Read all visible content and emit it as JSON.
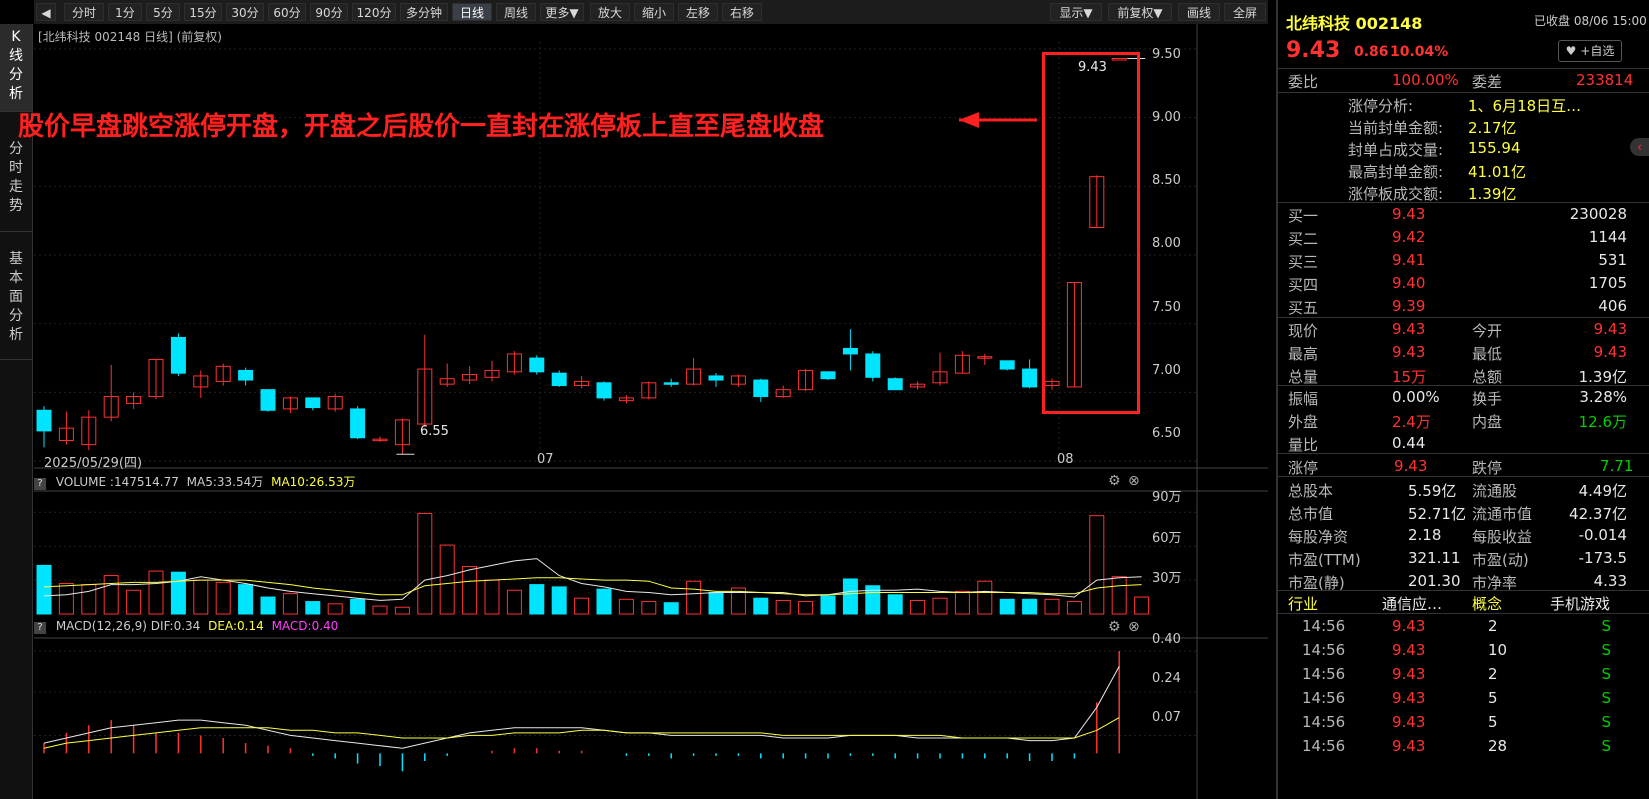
{
  "toolbar": {
    "back_icon": "back-arrow-icon",
    "periods": [
      "分时",
      "1分",
      "5分",
      "15分",
      "30分",
      "60分",
      "90分",
      "120分",
      "多分钟",
      "日线",
      "周线",
      "更多▼"
    ],
    "active_period": "日线",
    "actions": [
      "放大",
      "缩小",
      "左移",
      "右移"
    ],
    "right_buttons": [
      "显示▼",
      "前复权▼",
      "画线",
      "全屏"
    ]
  },
  "left_tabs": [
    "K线分析",
    "分时走势",
    "基本面分析"
  ],
  "chart": {
    "header": "[北纬科技 002148 日线]  (前复权)",
    "annotation": "股价早盘跳空涨停开盘，开盘之后股价一直封在涨停板上直至尾盘收盘",
    "start_date_label": "2025/05/29(四)",
    "month_labels": [
      "07",
      "08"
    ],
    "high_marker": "9.43",
    "low_marker": "6.55",
    "highlight_color": "#ff2020"
  },
  "volume_panel": {
    "title_name": "VOLUME",
    "title_value": ":147514.77",
    "ma5_label": "MA5:33.54万",
    "ma10_label": "MA10:26.53万"
  },
  "macd_panel": {
    "title_name": "MACD(12,26,9)",
    "dif_label": "DIF:0.34",
    "dea_label": "DEA:0.14",
    "macd_label": "MACD:0.40"
  },
  "chart_data": [
    {
      "type": "candlestick",
      "title": "[北纬科技 002148 日线]",
      "ylim": [
        6.45,
        9.55
      ],
      "y_ticks": [
        "9.50",
        "9.00",
        "8.50",
        "8.00",
        "7.50",
        "7.00",
        "6.50"
      ],
      "y_tick_values": [
        9.5,
        9.0,
        8.5,
        8.0,
        7.5,
        7.0,
        6.5
      ],
      "candles": [
        [
          6.87,
          6.72,
          6.9,
          6.6
        ],
        [
          6.65,
          6.74,
          6.86,
          6.62
        ],
        [
          6.62,
          6.82,
          6.87,
          6.58
        ],
        [
          6.82,
          6.97,
          7.2,
          6.79
        ],
        [
          6.92,
          6.97,
          7.0,
          6.88
        ],
        [
          6.97,
          7.24,
          7.24,
          6.95
        ],
        [
          7.4,
          7.14,
          7.43,
          7.12
        ],
        [
          7.04,
          7.12,
          7.16,
          6.96
        ],
        [
          7.08,
          7.19,
          7.21,
          7.05
        ],
        [
          7.16,
          7.09,
          7.18,
          7.05
        ],
        [
          7.02,
          6.87,
          7.02,
          6.86
        ],
        [
          6.88,
          6.96,
          6.97,
          6.85
        ],
        [
          6.96,
          6.89,
          6.96,
          6.87
        ],
        [
          6.88,
          6.97,
          6.99,
          6.86
        ],
        [
          6.88,
          6.67,
          6.9,
          6.66
        ],
        [
          6.66,
          6.66,
          6.68,
          6.64
        ],
        [
          6.62,
          6.8,
          6.81,
          6.55
        ],
        [
          6.77,
          7.17,
          7.42,
          6.75
        ],
        [
          7.06,
          7.1,
          7.21,
          7.04
        ],
        [
          7.09,
          7.13,
          7.19,
          7.06
        ],
        [
          7.11,
          7.16,
          7.23,
          7.08
        ],
        [
          7.15,
          7.28,
          7.3,
          7.13
        ],
        [
          7.25,
          7.15,
          7.27,
          7.13
        ],
        [
          7.14,
          7.05,
          7.16,
          7.04
        ],
        [
          7.05,
          7.08,
          7.12,
          7.03
        ],
        [
          7.07,
          6.96,
          7.08,
          6.94
        ],
        [
          6.94,
          6.96,
          6.98,
          6.92
        ],
        [
          6.96,
          7.07,
          7.08,
          6.95
        ],
        [
          7.07,
          7.06,
          7.1,
          7.04
        ],
        [
          7.06,
          7.17,
          7.25,
          7.05
        ],
        [
          7.12,
          7.09,
          7.14,
          7.04
        ],
        [
          7.06,
          7.12,
          7.13,
          7.04
        ],
        [
          7.09,
          6.97,
          7.1,
          6.93
        ],
        [
          6.97,
          7.02,
          7.05,
          6.96
        ],
        [
          7.02,
          7.16,
          7.17,
          7.01
        ],
        [
          7.15,
          7.1,
          7.15,
          7.09
        ],
        [
          7.32,
          7.28,
          7.46,
          7.16
        ],
        [
          7.28,
          7.11,
          7.3,
          7.08
        ],
        [
          7.1,
          7.02,
          7.11,
          7.02
        ],
        [
          7.04,
          7.06,
          7.08,
          7.02
        ],
        [
          7.07,
          7.15,
          7.29,
          7.05
        ],
        [
          7.14,
          7.27,
          7.3,
          7.14
        ],
        [
          7.26,
          7.26,
          7.28,
          7.2
        ],
        [
          7.23,
          7.17,
          7.23,
          7.16
        ],
        [
          7.17,
          7.04,
          7.24,
          7.03
        ],
        [
          7.05,
          7.08,
          7.1,
          7.02
        ],
        [
          7.04,
          7.8,
          7.8,
          7.04
        ],
        [
          8.2,
          8.57,
          8.58,
          8.2
        ],
        [
          9.43,
          9.43,
          9.43,
          9.43
        ]
      ]
    },
    {
      "type": "bar",
      "title": "VOLUME",
      "ylim": [
        0,
        1000000
      ],
      "y_ticks": [
        "90万",
        "60万",
        "30万"
      ],
      "y_tick_values": [
        900000,
        600000,
        300000
      ],
      "values": [
        430000,
        270000,
        260000,
        340000,
        210000,
        380000,
        370000,
        300000,
        280000,
        260000,
        150000,
        180000,
        110000,
        90000,
        130000,
        70000,
        60000,
        890000,
        610000,
        420000,
        300000,
        210000,
        260000,
        240000,
        140000,
        220000,
        130000,
        110000,
        100000,
        290000,
        190000,
        230000,
        140000,
        120000,
        110000,
        160000,
        310000,
        250000,
        170000,
        120000,
        140000,
        200000,
        290000,
        130000,
        130000,
        130000,
        110000,
        870000,
        330000,
        150000
      ],
      "ma5": [
        160000,
        170000,
        200000,
        260000,
        260000,
        270000,
        290000,
        330000,
        300000,
        270000,
        230000,
        200000,
        180000,
        160000,
        140000,
        120000,
        130000,
        300000,
        340000,
        390000,
        430000,
        470000,
        490000,
        340000,
        270000,
        240000,
        200000,
        190000,
        170000,
        180000,
        190000,
        190000,
        190000,
        190000,
        160000,
        170000,
        200000,
        210000,
        210000,
        220000,
        200000,
        190000,
        200000,
        190000,
        180000,
        170000,
        150000,
        300000,
        320000,
        330000
      ],
      "ma10": [
        240000,
        250000,
        260000,
        270000,
        280000,
        280000,
        290000,
        300000,
        300000,
        300000,
        280000,
        260000,
        230000,
        210000,
        190000,
        170000,
        170000,
        250000,
        270000,
        290000,
        300000,
        310000,
        320000,
        320000,
        310000,
        300000,
        300000,
        290000,
        230000,
        220000,
        200000,
        200000,
        190000,
        180000,
        170000,
        170000,
        180000,
        190000,
        190000,
        190000,
        190000,
        190000,
        190000,
        190000,
        190000,
        180000,
        180000,
        230000,
        250000,
        260000
      ]
    },
    {
      "type": "bar",
      "title": "MACD(12,26,9)",
      "ylim": [
        -0.12,
        0.42
      ],
      "y_ticks": [
        "0.40",
        "0.24",
        "0.07"
      ],
      "y_tick_values": [
        0.4,
        0.24,
        0.07
      ],
      "macd": [
        0.04,
        0.08,
        0.11,
        0.13,
        0.11,
        0.08,
        0.08,
        0.07,
        0.06,
        0.04,
        0.03,
        0.02,
        -0.01,
        -0.02,
        -0.04,
        -0.05,
        -0.07,
        -0.03,
        -0.01,
        0.0,
        0.01,
        0.02,
        0.02,
        0.01,
        0.01,
        0.0,
        -0.01,
        -0.01,
        -0.02,
        -0.01,
        -0.01,
        -0.01,
        -0.02,
        -0.02,
        -0.02,
        -0.02,
        -0.01,
        -0.01,
        -0.02,
        -0.02,
        -0.02,
        -0.02,
        -0.02,
        -0.02,
        -0.03,
        -0.03,
        -0.02,
        0.2,
        0.4
      ],
      "dif": [
        0.04,
        0.06,
        0.08,
        0.1,
        0.11,
        0.12,
        0.13,
        0.13,
        0.12,
        0.11,
        0.09,
        0.07,
        0.06,
        0.05,
        0.04,
        0.03,
        0.02,
        0.04,
        0.06,
        0.08,
        0.09,
        0.1,
        0.1,
        0.1,
        0.1,
        0.09,
        0.08,
        0.08,
        0.07,
        0.07,
        0.07,
        0.07,
        0.07,
        0.06,
        0.06,
        0.06,
        0.07,
        0.07,
        0.07,
        0.06,
        0.06,
        0.06,
        0.06,
        0.06,
        0.05,
        0.05,
        0.06,
        0.18,
        0.34
      ],
      "dea": [
        0.02,
        0.04,
        0.05,
        0.06,
        0.07,
        0.08,
        0.09,
        0.1,
        0.1,
        0.1,
        0.1,
        0.09,
        0.09,
        0.08,
        0.08,
        0.07,
        0.06,
        0.06,
        0.06,
        0.07,
        0.07,
        0.08,
        0.08,
        0.08,
        0.09,
        0.09,
        0.08,
        0.08,
        0.08,
        0.08,
        0.08,
        0.08,
        0.08,
        0.07,
        0.07,
        0.07,
        0.07,
        0.07,
        0.07,
        0.07,
        0.07,
        0.06,
        0.06,
        0.06,
        0.06,
        0.06,
        0.06,
        0.09,
        0.14
      ]
    }
  ],
  "quote": {
    "name_code": "北纬科技 002148",
    "status": "已收盘 08/06 15:00",
    "price": "9.43",
    "change": "0.86",
    "pct": "10.04%",
    "fav_label": "+自选",
    "weibi_label": "委比",
    "weibi_value": "100.00%",
    "weicha_label": "委差",
    "weicha_value": "233814",
    "limit_info": [
      {
        "label": "涨停分析:",
        "value": "1、6月18日互…"
      },
      {
        "label": "当前封单金额:",
        "value": "2.17亿"
      },
      {
        "label": "封单占成交量:",
        "value": "155.94"
      },
      {
        "label": "最高封单金额:",
        "value": "41.01亿"
      },
      {
        "label": "涨停板成交额:",
        "value": "1.39亿"
      }
    ],
    "bids": [
      {
        "label": "买一",
        "price": "9.43",
        "vol": "230028"
      },
      {
        "label": "买二",
        "price": "9.42",
        "vol": "1144"
      },
      {
        "label": "买三",
        "price": "9.41",
        "vol": "531"
      },
      {
        "label": "买四",
        "price": "9.40",
        "vol": "1705"
      },
      {
        "label": "买五",
        "price": "9.39",
        "vol": "406"
      }
    ],
    "stats_a": [
      [
        "现价",
        "9.43",
        "今开",
        "9.43"
      ],
      [
        "最高",
        "9.43",
        "最低",
        "9.43"
      ],
      [
        "总量",
        "15万",
        "总额",
        "1.39亿"
      ]
    ],
    "stats_b": [
      [
        "振幅",
        "0.00%",
        "换手",
        "3.28%"
      ],
      [
        "外盘",
        "2.4万",
        "内盘",
        "12.6万"
      ],
      [
        "量比",
        "0.44",
        "",
        ""
      ]
    ],
    "limits": [
      "涨停",
      "9.43",
      "跌停",
      "7.71"
    ],
    "fundamentals": [
      [
        "总股本",
        "5.59亿",
        "流通股",
        "4.49亿"
      ],
      [
        "总市值",
        "52.71亿",
        "流通市值",
        "42.37亿"
      ],
      [
        "每股净资",
        "2.18",
        "每股收益",
        "-0.014"
      ],
      [
        "市盈(TTM)",
        "321.11",
        "市盈(动)",
        "-173.5"
      ],
      [
        "市盈(静)",
        "201.30",
        "市净率",
        "4.33"
      ]
    ],
    "industry": [
      "行业",
      "通信应…",
      "概念",
      "手机游戏"
    ],
    "ticks": [
      [
        "14:56",
        "9.43",
        "2",
        "S"
      ],
      [
        "14:56",
        "9.43",
        "10",
        "S"
      ],
      [
        "14:56",
        "9.43",
        "2",
        "S"
      ],
      [
        "14:56",
        "9.43",
        "5",
        "S"
      ],
      [
        "14:56",
        "9.43",
        "5",
        "S"
      ],
      [
        "14:56",
        "9.43",
        "28",
        "S"
      ]
    ]
  }
}
